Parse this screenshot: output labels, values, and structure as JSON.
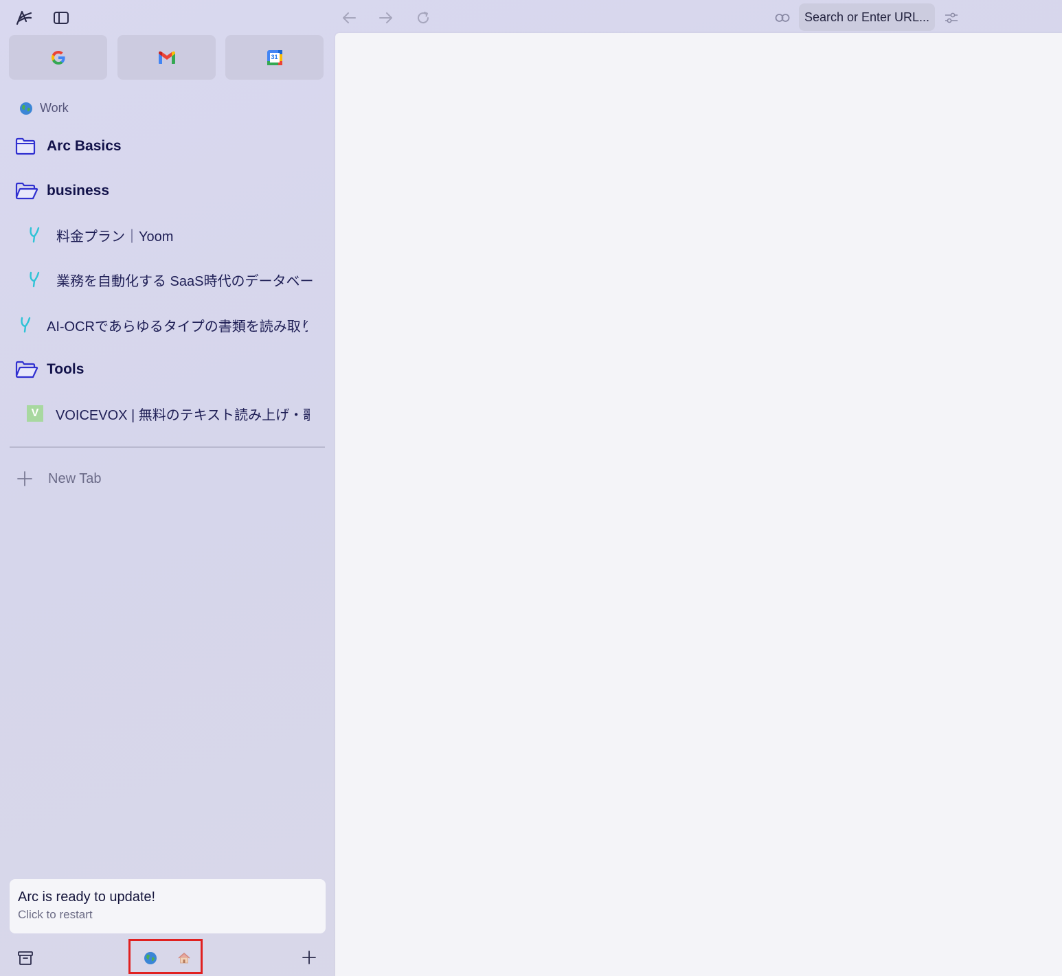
{
  "toolbar": {
    "url_placeholder": "Search or Enter URL..."
  },
  "icons": {
    "arc": "arc-logo-icon",
    "sidebar_toggle": "sidebar-toggle-icon",
    "back": "back-arrow-icon",
    "forward": "forward-arrow-icon",
    "reload": "reload-icon",
    "link": "link-icon",
    "settings": "sliders-icon",
    "archive": "archive-icon",
    "add": "plus-icon"
  },
  "pinned": [
    {
      "name": "Google",
      "icon": "google-icon"
    },
    {
      "name": "Gmail",
      "icon": "gmail-icon"
    },
    {
      "name": "Google Calendar",
      "icon": "calendar-icon",
      "day": "31"
    }
  ],
  "space": {
    "title": "Work"
  },
  "sidebar": {
    "items": [
      {
        "type": "folder",
        "label": "Arc Basics",
        "open": false
      },
      {
        "type": "folder",
        "label": "business",
        "open": true
      },
      {
        "type": "tab",
        "label": "料金プラン｜Yoom",
        "icon": "yoom-icon"
      },
      {
        "type": "tab",
        "label": "業務を自動化する SaaS時代のデータベース...",
        "icon": "yoom-icon"
      },
      {
        "type": "tab",
        "label": "AI-OCRであらゆるタイプの書類を読み取り、...",
        "icon": "yoom-icon"
      },
      {
        "type": "folder",
        "label": "Tools",
        "open": true
      },
      {
        "type": "tab",
        "label": "VOICEVOX | 無料のテキスト読み上げ・歌...",
        "icon": "voicevox-icon",
        "badge": "V"
      }
    ],
    "new_tab": "New Tab"
  },
  "update_banner": {
    "title": "Arc is ready to update!",
    "subtitle": "Click to restart"
  },
  "colors": {
    "accent": "#3a3ad6",
    "yoom": "#2ec3d6",
    "voicevox": "#a8d8a0",
    "highlight": "#e02020"
  }
}
